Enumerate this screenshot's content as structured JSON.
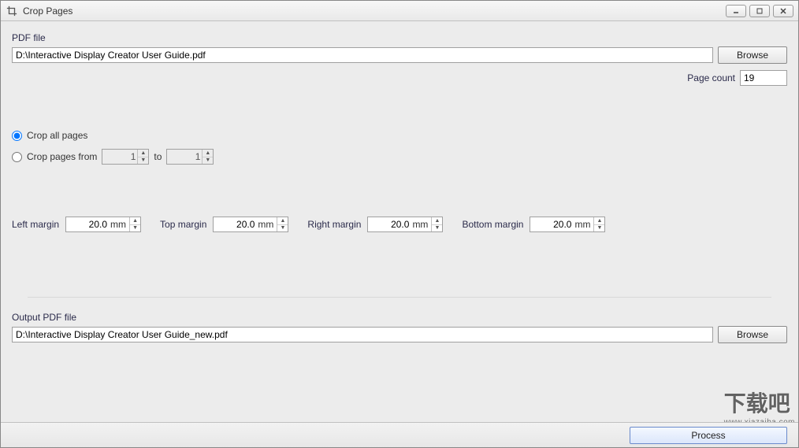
{
  "window": {
    "title": "Crop Pages"
  },
  "pdf": {
    "label": "PDF file",
    "path": "D:\\Interactive Display Creator User Guide.pdf",
    "browse": "Browse",
    "page_count_label": "Page count",
    "page_count": "19"
  },
  "range": {
    "all_label": "Crop all pages",
    "from_label": "Crop pages from",
    "to_label": "to",
    "from_value": "1",
    "to_value": "1"
  },
  "margins": {
    "left_label": "Left margin",
    "left_value": "20.0",
    "top_label": "Top margin",
    "top_value": "20.0",
    "right_label": "Right margin",
    "right_value": "20.0",
    "bottom_label": "Bottom margin",
    "bottom_value": "20.0",
    "unit": "mm"
  },
  "output": {
    "label": "Output PDF file",
    "path": "D:\\Interactive Display Creator User Guide_new.pdf",
    "browse": "Browse"
  },
  "actions": {
    "process": "Process"
  },
  "watermark": {
    "main": "下载吧",
    "sub": "www.xiazaiba.com"
  }
}
